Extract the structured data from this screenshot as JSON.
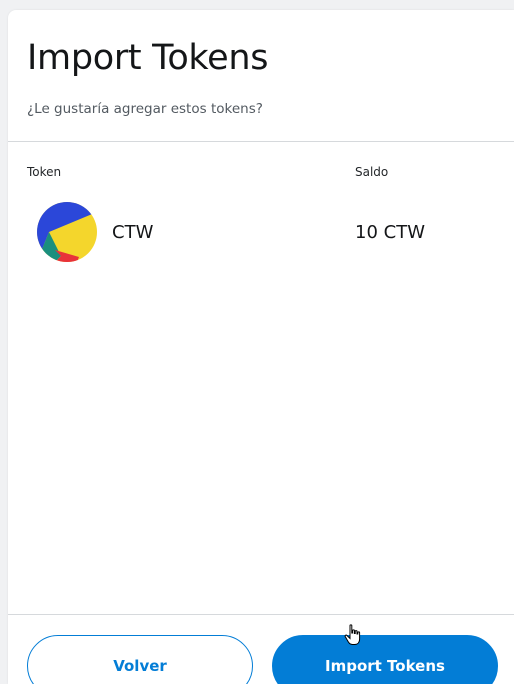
{
  "header": {
    "title": "Import Tokens",
    "subtitle": "¿Le gustaría agregar estos tokens?"
  },
  "table": {
    "columns": [
      "Token",
      "Saldo"
    ],
    "rows": [
      {
        "symbol": "CTW",
        "balance": "10 CTW",
        "icon": "ctw-token-icon"
      }
    ]
  },
  "footer": {
    "back_label": "Volver",
    "import_label": "Import Tokens"
  },
  "colors": {
    "accent": "#037dd6",
    "divider": "#d6d9dc",
    "text_primary": "#141618",
    "text_secondary": "#535a61"
  }
}
